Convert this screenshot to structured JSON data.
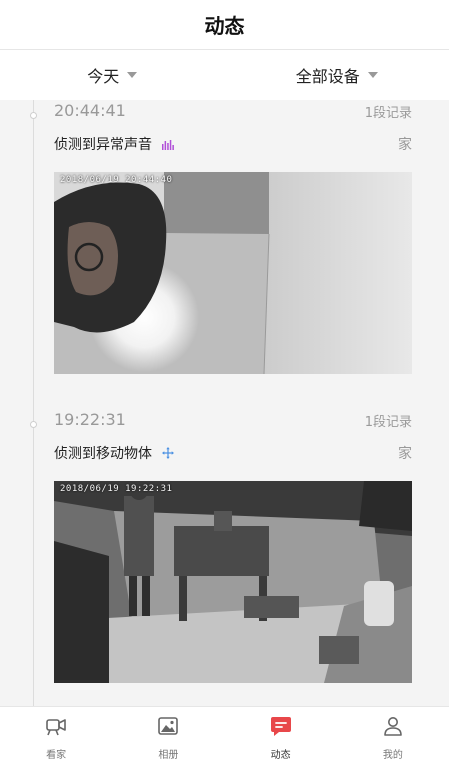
{
  "header": {
    "title": "动态"
  },
  "filters": {
    "date": {
      "label": "今天"
    },
    "device": {
      "label": "全部设备"
    }
  },
  "events": [
    {
      "time": "20:44:41",
      "count": "1段记录",
      "description": "侦测到异常声音",
      "icon": "sound-wave-icon",
      "icon_color": "#b04fd8",
      "location": "家",
      "overlay_timestamp": "2018/06/19  20:44:40"
    },
    {
      "time": "19:22:31",
      "count": "1段记录",
      "description": "侦测到移动物体",
      "icon": "move-arrows-icon",
      "icon_color": "#4a90e2",
      "location": "家",
      "overlay_timestamp": "2018/06/19  19:22:31"
    }
  ],
  "tabbar": {
    "active_color": "#e8474a",
    "items": [
      {
        "label": "看家",
        "icon": "camera-icon"
      },
      {
        "label": "相册",
        "icon": "album-icon"
      },
      {
        "label": "动态",
        "icon": "message-icon",
        "active": true
      },
      {
        "label": "我的",
        "icon": "user-icon"
      }
    ]
  }
}
